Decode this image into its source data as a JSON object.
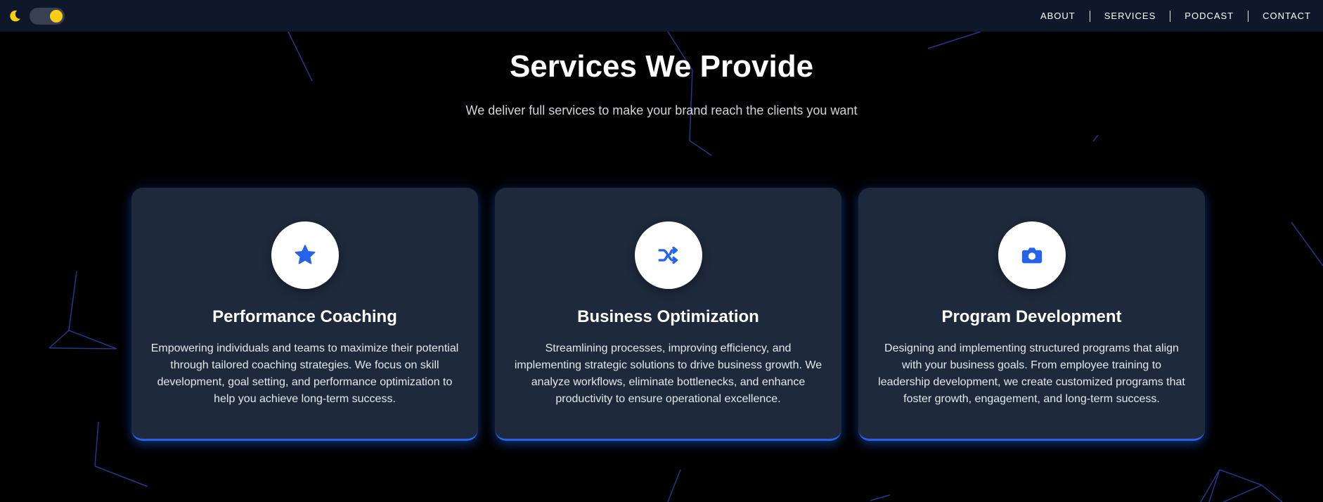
{
  "nav": {
    "links": [
      "ABOUT",
      "SERVICES",
      "PODCAST",
      "CONTACT"
    ],
    "theme_toggle": {
      "icon": "moon-icon",
      "state": "on"
    }
  },
  "hero": {
    "title": "Services We Provide",
    "subtitle": "We deliver full services to make your brand reach the clients you want"
  },
  "services": [
    {
      "icon": "star-icon",
      "title": "Performance Coaching",
      "description": "Empowering individuals and teams to maximize their potential through tailored coaching strategies. We focus on skill development, goal setting, and performance optimization to help you achieve long-term success."
    },
    {
      "icon": "shuffle-icon",
      "title": "Business Optimization",
      "description": "Streamlining processes, improving efficiency, and implementing strategic solutions to drive business growth. We analyze workflows, eliminate bottlenecks, and enhance productivity to ensure operational excellence."
    },
    {
      "icon": "camera-icon",
      "title": "Program Development",
      "description": "Designing and implementing structured programs that align with your business goals. From employee training to leadership development, we create customized programs that foster growth, engagement, and long-term success."
    }
  ],
  "colors": {
    "background": "#000000",
    "navbar": "#0f172a",
    "card": "#1e293b",
    "accent": "#2563eb",
    "toggle_knob": "#facc15"
  }
}
